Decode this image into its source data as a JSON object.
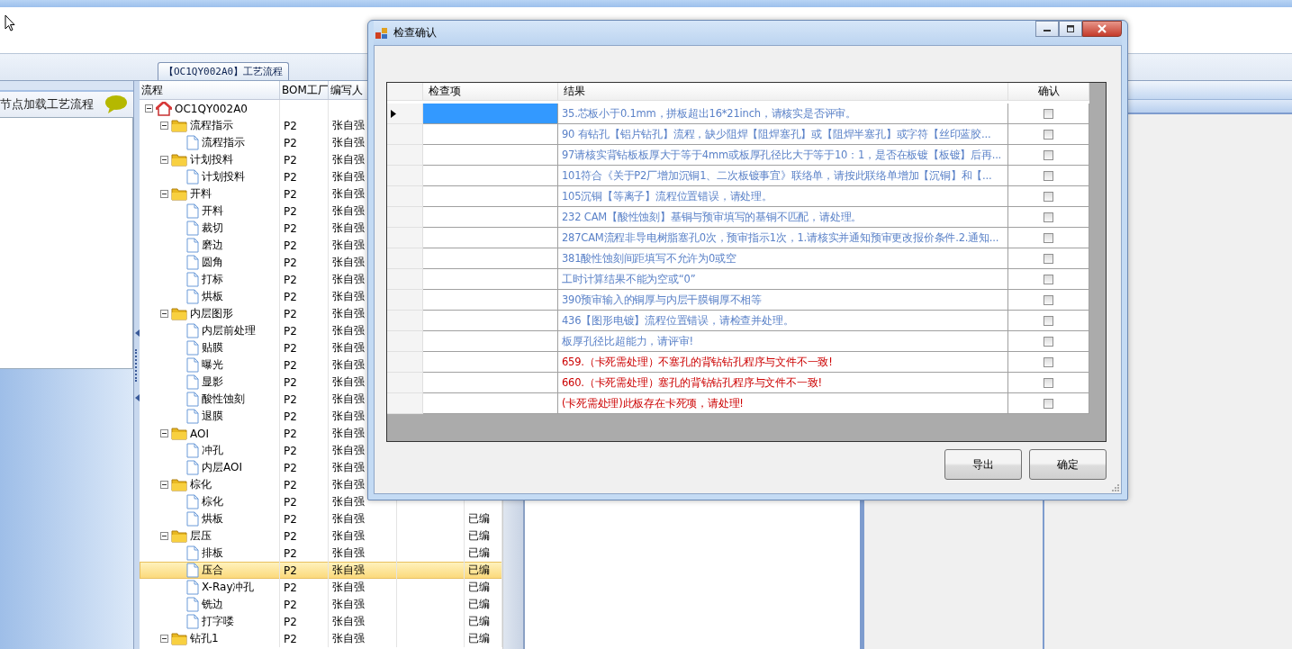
{
  "flow_tab": {
    "label": "【OC1QY002A0】工艺流程",
    "selected": true
  },
  "left_panel": {
    "title": "节点加载工艺流程"
  },
  "tree": {
    "columns": [
      "流程",
      "BOM工厂",
      "编写人"
    ],
    "root": {
      "label": "OC1QY002A0",
      "kind": "home",
      "expanded": true,
      "selected": false,
      "children": [
        {
          "label": "流程指示",
          "kind": "folder",
          "bom": "P2",
          "author": "张自强",
          "expanded": true,
          "selected": false,
          "children": [
            {
              "label": "流程指示",
              "kind": "file",
              "bom": "P2",
              "author": "张自强",
              "selected": false
            }
          ]
        },
        {
          "label": "计划投料",
          "kind": "folder",
          "bom": "P2",
          "author": "张自强",
          "expanded": true,
          "selected": false,
          "children": [
            {
              "label": "计划投料",
              "kind": "file",
              "bom": "P2",
              "author": "张自强",
              "selected": false
            }
          ]
        },
        {
          "label": "开料",
          "kind": "folder",
          "bom": "P2",
          "author": "张自强",
          "expanded": true,
          "selected": false,
          "children": [
            {
              "label": "开料",
              "kind": "file",
              "bom": "P2",
              "author": "张自强",
              "selected": false
            },
            {
              "label": "裁切",
              "kind": "file",
              "bom": "P2",
              "author": "张自强",
              "selected": false
            },
            {
              "label": "磨边",
              "kind": "file",
              "bom": "P2",
              "author": "张自强",
              "selected": false
            },
            {
              "label": "圆角",
              "kind": "file",
              "bom": "P2",
              "author": "张自强",
              "selected": false
            },
            {
              "label": "打标",
              "kind": "file",
              "bom": "P2",
              "author": "张自强",
              "selected": false
            },
            {
              "label": "烘板",
              "kind": "file",
              "bom": "P2",
              "author": "张自强",
              "selected": false
            }
          ]
        },
        {
          "label": "内层图形",
          "kind": "folder",
          "bom": "P2",
          "author": "张自强",
          "expanded": true,
          "selected": false,
          "children": [
            {
              "label": "内层前处理",
              "kind": "file",
              "bom": "P2",
              "author": "张自强",
              "selected": false
            },
            {
              "label": "贴膜",
              "kind": "file",
              "bom": "P2",
              "author": "张自强",
              "selected": false
            },
            {
              "label": "曝光",
              "kind": "file",
              "bom": "P2",
              "author": "张自强",
              "selected": false
            },
            {
              "label": "显影",
              "kind": "file",
              "bom": "P2",
              "author": "张自强",
              "selected": false
            },
            {
              "label": "酸性蚀刻",
              "kind": "file",
              "bom": "P2",
              "author": "张自强",
              "selected": false
            },
            {
              "label": "退膜",
              "kind": "file",
              "bom": "P2",
              "author": "张自强",
              "selected": false
            }
          ]
        },
        {
          "label": "AOI",
          "kind": "folder",
          "bom": "P2",
          "author": "张自强",
          "expanded": true,
          "selected": false,
          "children": [
            {
              "label": "冲孔",
              "kind": "file",
              "bom": "P2",
              "author": "张自强",
              "selected": false
            },
            {
              "label": "内层AOI",
              "kind": "file",
              "bom": "P2",
              "author": "张自强",
              "selected": false
            }
          ]
        },
        {
          "label": "棕化",
          "kind": "folder",
          "bom": "P2",
          "author": "张自强",
          "expanded": true,
          "selected": false,
          "children": [
            {
              "label": "棕化",
              "kind": "file",
              "bom": "P2",
              "author": "张自强",
              "selected": false
            },
            {
              "label": "烘板",
              "kind": "file",
              "bom": "P2",
              "author": "张自强",
              "status": "已编",
              "selected": false
            }
          ]
        },
        {
          "label": "层压",
          "kind": "folder",
          "bom": "P2",
          "author": "张自强",
          "status": "已编",
          "expanded": true,
          "selected": false,
          "children": [
            {
              "label": "排板",
              "kind": "file",
              "bom": "P2",
              "author": "张自强",
              "status": "已编",
              "selected": false
            },
            {
              "label": "压合",
              "kind": "file",
              "bom": "P2",
              "author": "张自强",
              "status": "已编",
              "selected": true
            },
            {
              "label": "X-Ray冲孔",
              "kind": "file",
              "bom": "P2",
              "author": "张自强",
              "status": "已编",
              "selected": false
            },
            {
              "label": "铣边",
              "kind": "file",
              "bom": "P2",
              "author": "张自强",
              "status": "已编",
              "selected": false
            },
            {
              "label": "打字喽",
              "kind": "file",
              "bom": "P2",
              "author": "张自强",
              "status": "已编",
              "selected": false
            }
          ]
        },
        {
          "label": "钻孔1",
          "kind": "folder",
          "bom": "P2",
          "author": "张自强",
          "status": "已编",
          "expanded": true,
          "selected": false
        }
      ]
    }
  },
  "dialog": {
    "title": "检查确认",
    "columns": [
      "检查项",
      "结果",
      "确认"
    ],
    "rows": [
      {
        "result": "35.芯板小于0.1mm，拼板超出16*21inch，请核实是否评审。",
        "color": "#5b82c8",
        "selected": true,
        "confirmed": false
      },
      {
        "result": "90 有钻孔【铝片钻孔】流程，缺少阻焊【阻焊塞孔】或【阻焊半塞孔】或字符【丝印蓝胶...",
        "color": "#5b82c8",
        "selected": false,
        "confirmed": false
      },
      {
        "result": "97请核实背钻板板厚大于等于4mm或板厚孔径比大于等于10：1，是否在板镀【板镀】后再...",
        "color": "#5b82c8",
        "selected": false,
        "confirmed": false
      },
      {
        "result": "101符合《关于P2厂增加沉铜1、二次板镀事宜》联络单，请按此联络单增加【沉铜】和【...",
        "color": "#5b82c8",
        "selected": false,
        "confirmed": false
      },
      {
        "result": "105沉铜【等离子】流程位置错误，请处理。",
        "color": "#5b82c8",
        "selected": false,
        "confirmed": false
      },
      {
        "result": "232 CAM【酸性蚀刻】基铜与预审填写的基铜不匹配，请处理。",
        "color": "#5b82c8",
        "selected": false,
        "confirmed": false
      },
      {
        "result": "287CAM流程非导电树脂塞孔0次，预审指示1次，1.请核实并通知预审更改报价条件.2.通知...",
        "color": "#5b82c8",
        "selected": false,
        "confirmed": false
      },
      {
        "result": "381酸性蚀刻间距填写不允许为0或空",
        "color": "#5b82c8",
        "selected": false,
        "confirmed": false
      },
      {
        "result": "工时计算结果不能为空或“0”",
        "color": "#5b82c8",
        "selected": false,
        "confirmed": false
      },
      {
        "result": "390预审输入的铜厚与内层干膜铜厚不相等",
        "color": "#5b82c8",
        "selected": false,
        "confirmed": false
      },
      {
        "result": "436【图形电镀】流程位置错误，请检查并处理。",
        "color": "#5b82c8",
        "selected": false,
        "confirmed": false
      },
      {
        "result": "板厚孔径比超能力，请评审!",
        "color": "#5b82c8",
        "selected": false,
        "confirmed": false
      },
      {
        "result": "659.（卡死需处理）不塞孔的背钻钻孔程序与文件不一致!",
        "color": "#cc0000",
        "selected": false,
        "confirmed": false
      },
      {
        "result": "660.（卡死需处理）塞孔的背钻钻孔程序与文件不一致!",
        "color": "#cc0000",
        "selected": false,
        "confirmed": false
      },
      {
        "result": "(卡死需处理)此板存在卡死项，请处理!",
        "color": "#cc0000",
        "selected": false,
        "confirmed": false
      }
    ],
    "buttons": [
      "导出",
      "确定"
    ]
  }
}
